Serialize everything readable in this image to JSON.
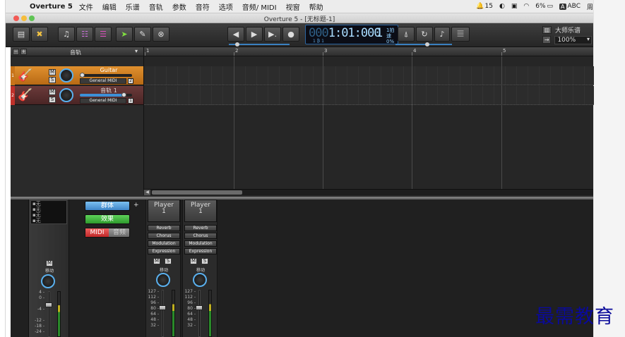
{
  "menubar": {
    "app_name": "Overture 5",
    "items": [
      "文件",
      "编辑",
      "乐谱",
      "音轨",
      "参数",
      "音符",
      "选项",
      "音频/ MIDI",
      "视窗",
      "帮助"
    ],
    "status": {
      "notif_count": "15",
      "battery": "6%",
      "input_badge": "A",
      "input": "ABC",
      "day": "周"
    }
  },
  "window": {
    "title": "Overture 5 - [无标题-1]"
  },
  "transport": {
    "lcd_dim": "000",
    "lcd_main": "1:01:000",
    "lcd_beat": "1",
    "lcd_small_top": "1拍速",
    "lcd_small_bot": "0%",
    "lcd_sub": "1 ₿ 1"
  },
  "toolbar_right": {
    "score_label": "大师乐谱",
    "zoom": "100%"
  },
  "track_header": {
    "title": "音轨"
  },
  "ruler": {
    "marks": [
      "1",
      "2",
      "3",
      "4",
      "5"
    ]
  },
  "tracks": [
    {
      "num": "1",
      "name": "Guitar",
      "instrument": "General MIDI",
      "channel": "2",
      "m": "M",
      "s": "S",
      "volume": 0.05
    },
    {
      "num": "2",
      "name": "音轨 1",
      "instrument": "General MIDI",
      "channel": "1",
      "m": "M",
      "s": "S",
      "volume": 0.85
    }
  ],
  "mixer": {
    "master_list": [
      "无",
      "无",
      "无",
      "无"
    ],
    "group_label": "群体",
    "effects_label": "效果",
    "midi_label": "MIDI",
    "audio_label": "音频",
    "plus": "+",
    "master_m": "M",
    "master_pan_label": "移动",
    "master_scale": [
      "4 -",
      "0 -",
      "-4 -",
      "-12 -",
      "-18 -",
      "-24 -"
    ],
    "strips": [
      {
        "player_label": "Player",
        "player_num": "1",
        "fx": [
          "Reverb",
          "Chorus",
          "Modulation",
          "Expression"
        ],
        "m": "M",
        "s": "S",
        "pan_label": "移动",
        "scale": [
          "127 -",
          "112 -",
          "96 -",
          "80 -",
          "64 -",
          "48 -",
          "32 -"
        ]
      },
      {
        "player_label": "Player",
        "player_num": "1",
        "fx": [
          "Reverb",
          "Chorus",
          "Modulation",
          "Expression"
        ],
        "m": "M",
        "s": "S",
        "pan_label": "移动",
        "scale": [
          "127 -",
          "112 -",
          "96 -",
          "80 -",
          "64 -",
          "48 -",
          "32 -"
        ]
      }
    ]
  },
  "watermark": "最需教育"
}
